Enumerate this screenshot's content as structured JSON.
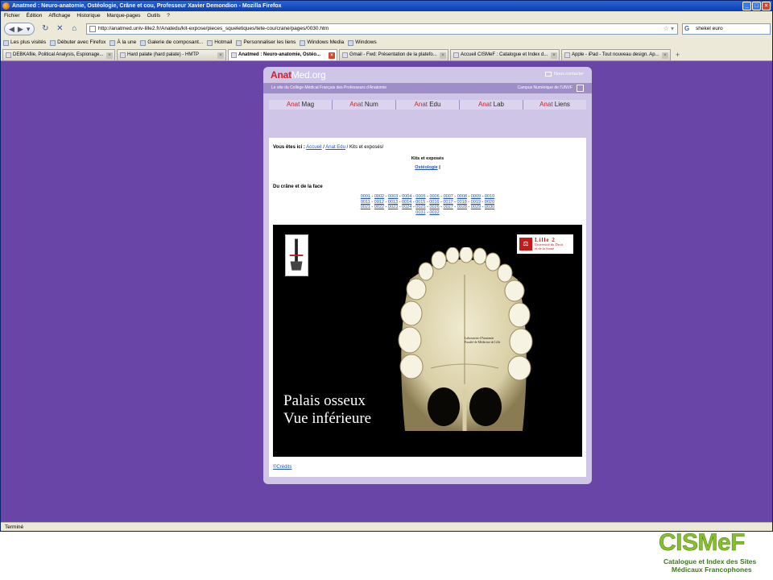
{
  "browser": {
    "title": "Anatmed : Neuro-anatomie, Ostéologie, Crâne et cou, Professeur Xavier Demondion - Mozilla Firefox",
    "menu": [
      "Fichier",
      "Édition",
      "Affichage",
      "Historique",
      "Marque-pages",
      "Outils",
      "?"
    ],
    "url": "http://anatmed.univ-lille2.fr/Anatedu/kit-expose/pieces_squeletiques/tete-cou/crane/pages/0030.htm",
    "search": "shekel euro",
    "bookmarks": [
      "Les plus visités",
      "Débuter avec Firefox",
      "À la une",
      "Galerie de composant...",
      "Hotmail",
      "Personnaliser les liens",
      "Windows Media",
      "Windows"
    ],
    "tabs": [
      {
        "label": "DEBKAfile, Political Analysis, Espionage...",
        "active": false
      },
      {
        "label": "Hard palate (hard palate) - HMTP",
        "active": false
      },
      {
        "label": "Anatmed : Neuro-anatomie, Ostéo...",
        "active": true
      },
      {
        "label": "Gmail - Fwd: Présentation de la platefo...",
        "active": false
      },
      {
        "label": "Accueil CISMeF : Catalogue et Index d...",
        "active": false
      },
      {
        "label": "Apple - iPad - Tout nouveau design. Ap...",
        "active": false
      }
    ],
    "status": "Terminé"
  },
  "site": {
    "logo_red": "Anat",
    "logo_rest": "Med.org",
    "contact": "Nous contacter",
    "tagline": "Le site du Collège Médical Français des Professeurs d'Anatomie",
    "campus": "Campus Numérique de l'UNVF",
    "nav": [
      {
        "red": "Anat",
        "rest": " Mag"
      },
      {
        "red": "Anat",
        "rest": " Num"
      },
      {
        "red": "Anat",
        "rest": " Edu"
      },
      {
        "red": "Anat",
        "rest": " Lab"
      },
      {
        "red": "Anat",
        "rest": " Liens"
      }
    ]
  },
  "main": {
    "breadcrumb_label": "Vous êtes ici :",
    "breadcrumb": [
      "Accueil",
      "Anat Edu",
      "Kits et exposés/"
    ],
    "kits_title": "Kits et exposés",
    "osteo_link": "Ostéologie",
    "section_title": "Du crâne et de la face",
    "page_rows": [
      [
        "0001",
        "0002",
        "0003",
        "0004",
        "0005",
        "0006",
        "0007",
        "0008",
        "0009",
        "0010"
      ],
      [
        "0011",
        "0012",
        "0013",
        "0014",
        "0015",
        "0016",
        "0017",
        "0018",
        "0019",
        "0020"
      ],
      [
        "0021",
        "0022",
        "0023",
        "0024",
        "0025",
        "0026",
        "0027",
        "0028",
        "0029",
        "0030"
      ],
      [
        "0031",
        "0032"
      ]
    ],
    "poster": {
      "title_line1": "Palais osseux",
      "title_line2": "Vue inférieure",
      "lab_line1": "Laboratoire d'Anatomie",
      "lab_line2": "Faculté de Médecine de Lille",
      "lille_big": "Lille 2",
      "lille_line1": "Université du Droit",
      "lille_line2": "et de la Santé"
    },
    "credits": "©Crédits"
  },
  "cismef": {
    "word": "CISMeF",
    "line1": "Catalogue et Index des Sites",
    "line2": "Médicaux Francophones"
  },
  "colors": {
    "page_background": "#6a45a8",
    "panel": "#cfc5e6",
    "accent_red": "#d2202b",
    "link": "#2152c4",
    "cismef_green": "#85bf2a"
  }
}
